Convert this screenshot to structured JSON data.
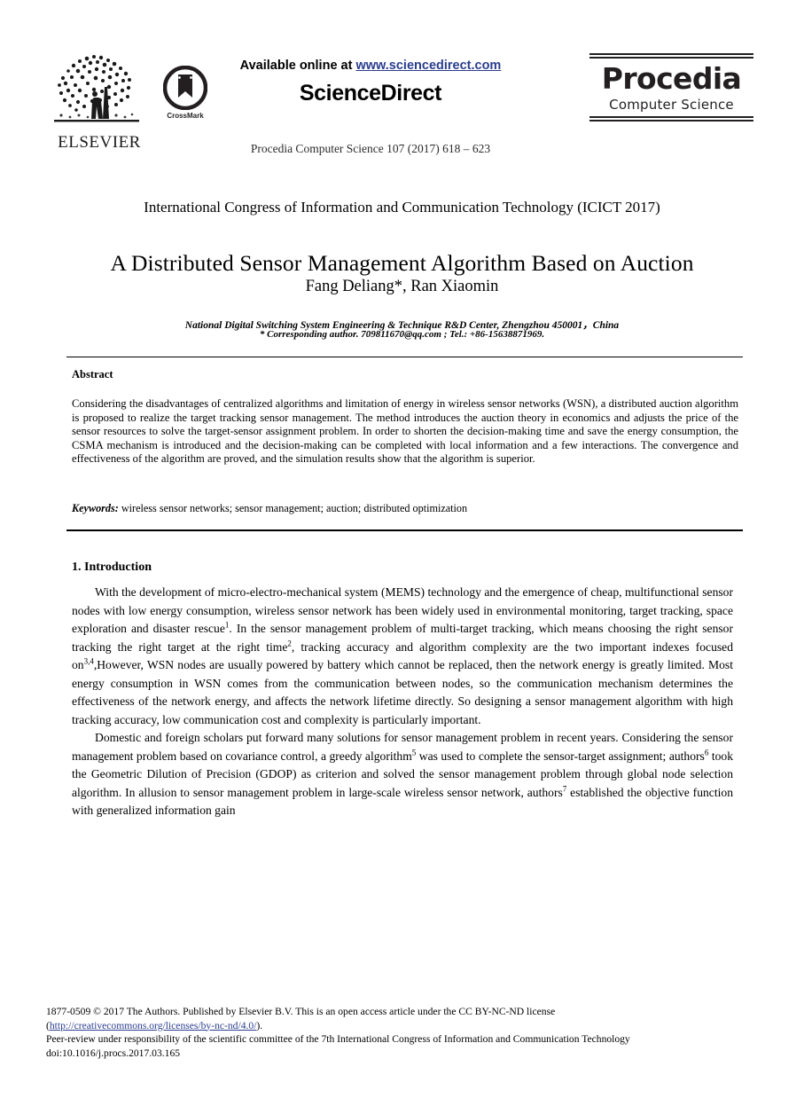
{
  "masthead": {
    "elsevier_wordmark": "ELSEVIER",
    "crossmark_label": "CrossMark",
    "available_prefix": "Available online at ",
    "sciencedirect_url": "www.sciencedirect.com",
    "sciencedirect_wordmark": "ScienceDirect",
    "journal_reference": "Procedia Computer Science 107 (2017) 618 – 623",
    "procedia_name": "Procedia",
    "procedia_subtitle": "Computer Science",
    "url_color": "#2a3d8f",
    "ink_color": "#231f20"
  },
  "title_block": {
    "conference": "International Congress of Information and Communication Technology (ICICT 2017)",
    "title": "A Distributed Sensor Management Algorithm Based on Auction",
    "authors": "Fang Deliang*, Ran Xiaomin",
    "affiliation": "National Digital Switching System Engineering & Technique R&D Center, Zhengzhou 450001，China",
    "corresponding": "* Corresponding author. 709811670@qq.com ; Tel.: +86-15638871969."
  },
  "abstract": {
    "heading": "Abstract",
    "body": "Considering the disadvantages of centralized algorithms and limitation of energy in wireless sensor networks (WSN), a distributed auction algorithm is proposed to realize the target tracking sensor management. The method introduces the auction theory in economics and adjusts the price of the sensor resources to solve the target-sensor assignment problem. In order to shorten the decision-making time and save the energy consumption, the CSMA mechanism is introduced and the decision-making can be completed with local information and a few interactions. The convergence and effectiveness of the algorithm are proved, and the simulation results show that the algorithm is superior.",
    "keywords_label": "Keywords:",
    "keywords_value": " wireless sensor networks; sensor management; auction; distributed optimization"
  },
  "section": {
    "heading": "1. Introduction",
    "paragraph_1_a": "With the development of micro-electro-mechanical system (MEMS) technology and the emergence of cheap, multifunctional sensor nodes with low energy consumption, wireless sensor network has been widely used in environmental monitoring, target tracking, space exploration and disaster rescue",
    "sup_1": "1",
    "paragraph_1_b": ". In the sensor management problem of multi-target tracking, which means choosing the right sensor tracking the right target at the right time",
    "sup_2": "2",
    "paragraph_1_c": ", tracking accuracy and algorithm complexity are the two important indexes focused on",
    "sup_3": "3,4",
    "paragraph_1_d": ",However, WSN nodes are usually powered by battery which cannot be replaced, then the network energy is greatly limited. Most energy consumption in WSN comes from the communication between nodes, so the communication mechanism determines the effectiveness of the network energy, and affects the network lifetime directly. So designing a sensor management algorithm with high tracking accuracy, low communication cost and complexity is particularly important.",
    "paragraph_2_a": "Domestic and foreign scholars put forward many solutions for sensor management problem in recent years. Considering the sensor management problem based on covariance control, a greedy algorithm",
    "sup_5": "5",
    "paragraph_2_b": " was used to complete the sensor-target assignment; authors",
    "sup_6": "6",
    "paragraph_2_c": " took the Geometric Dilution of Precision (GDOP) as criterion and solved the sensor management problem through global node selection algorithm. In allusion to sensor management problem in large-scale wireless sensor network, authors",
    "sup_7": "7",
    "paragraph_2_d": " established the objective function with generalized information gain"
  },
  "footer": {
    "line1": "1877-0509 © 2017 The Authors. Published by Elsevier B.V. This is an open access article under the CC BY-NC-ND license",
    "license_open_paren": "(",
    "license_url": "http://creativecommons.org/licenses/by-nc-nd/4.0/",
    "license_close": ").",
    "line3": "Peer-review under responsibility of the scientific committee of the 7th International Congress of Information and Communication Technology",
    "line4": "doi:10.1016/j.procs.2017.03.165"
  }
}
